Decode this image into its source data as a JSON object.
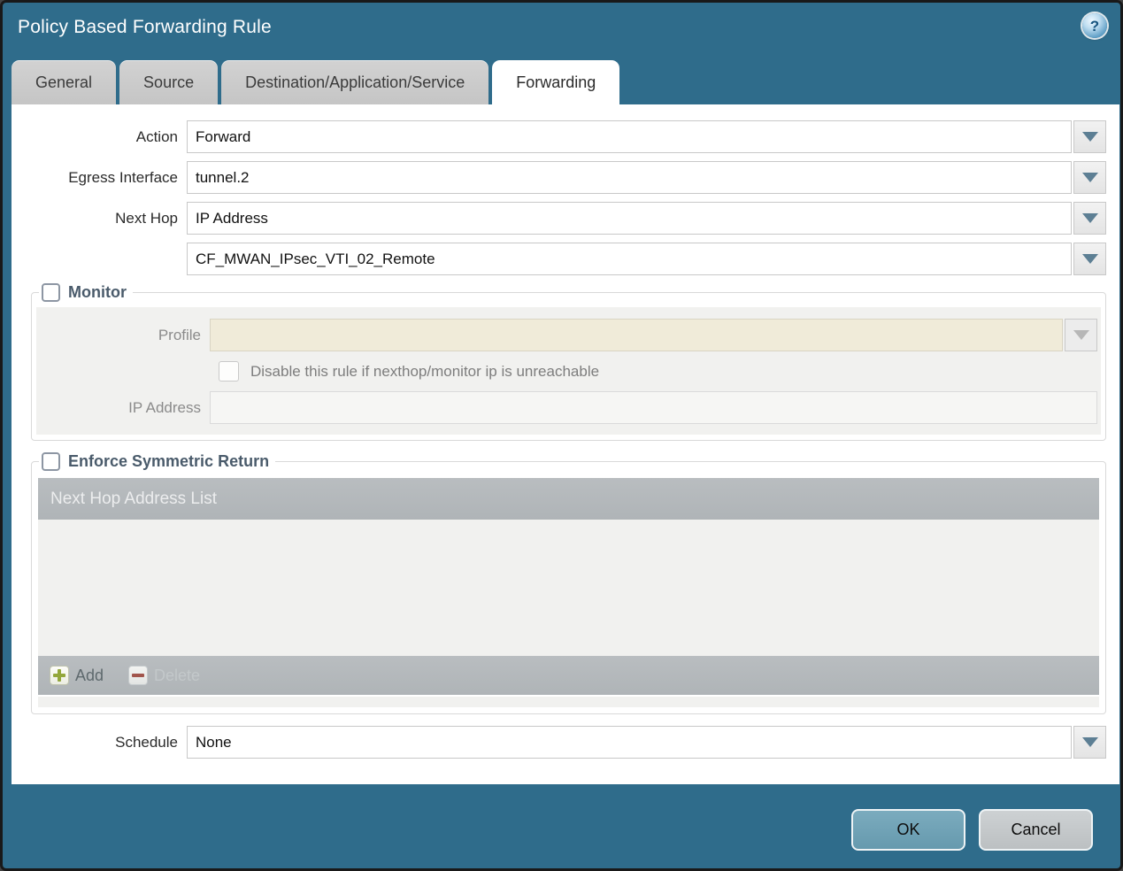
{
  "window": {
    "title": "Policy Based Forwarding Rule"
  },
  "tabs": [
    {
      "label": "General",
      "active": false
    },
    {
      "label": "Source",
      "active": false
    },
    {
      "label": "Destination/Application/Service",
      "active": false
    },
    {
      "label": "Forwarding",
      "active": true
    }
  ],
  "form": {
    "action": {
      "label": "Action",
      "value": "Forward"
    },
    "egress_interface": {
      "label": "Egress Interface",
      "value": "tunnel.2"
    },
    "next_hop": {
      "label": "Next Hop",
      "value": "IP Address"
    },
    "next_hop_address": {
      "value": "CF_MWAN_IPsec_VTI_02_Remote"
    },
    "schedule": {
      "label": "Schedule",
      "value": "None"
    }
  },
  "monitor": {
    "title": "Monitor",
    "checked": false,
    "profile": {
      "label": "Profile",
      "value": ""
    },
    "disable_rule_label": "Disable this rule if nexthop/monitor ip is unreachable",
    "disable_rule_checked": false,
    "ip_address": {
      "label": "IP Address",
      "value": ""
    }
  },
  "symmetric_return": {
    "title": "Enforce Symmetric Return",
    "checked": false,
    "table_header": "Next Hop Address List",
    "rows": [],
    "add_label": "Add",
    "delete_label": "Delete"
  },
  "footer": {
    "ok_label": "OK",
    "cancel_label": "Cancel"
  },
  "icons": {
    "help": "question-mark-icon",
    "dropdown": "chevron-down-icon",
    "add": "plus-icon",
    "delete": "minus-icon"
  },
  "colors": {
    "titlebar_teal": "#2f6c8b",
    "active_tab_bg": "#ffffff",
    "inactive_tab_bg": "#c9c9c9",
    "table_header_gray": "#b2b7ba",
    "disabled_field_beige": "#f0ebd9",
    "panel_gray": "#f1f1ef",
    "ok_button": "#6fa1b5",
    "cancel_button": "#c3c7c9",
    "section_title": "#4a5b6b"
  }
}
